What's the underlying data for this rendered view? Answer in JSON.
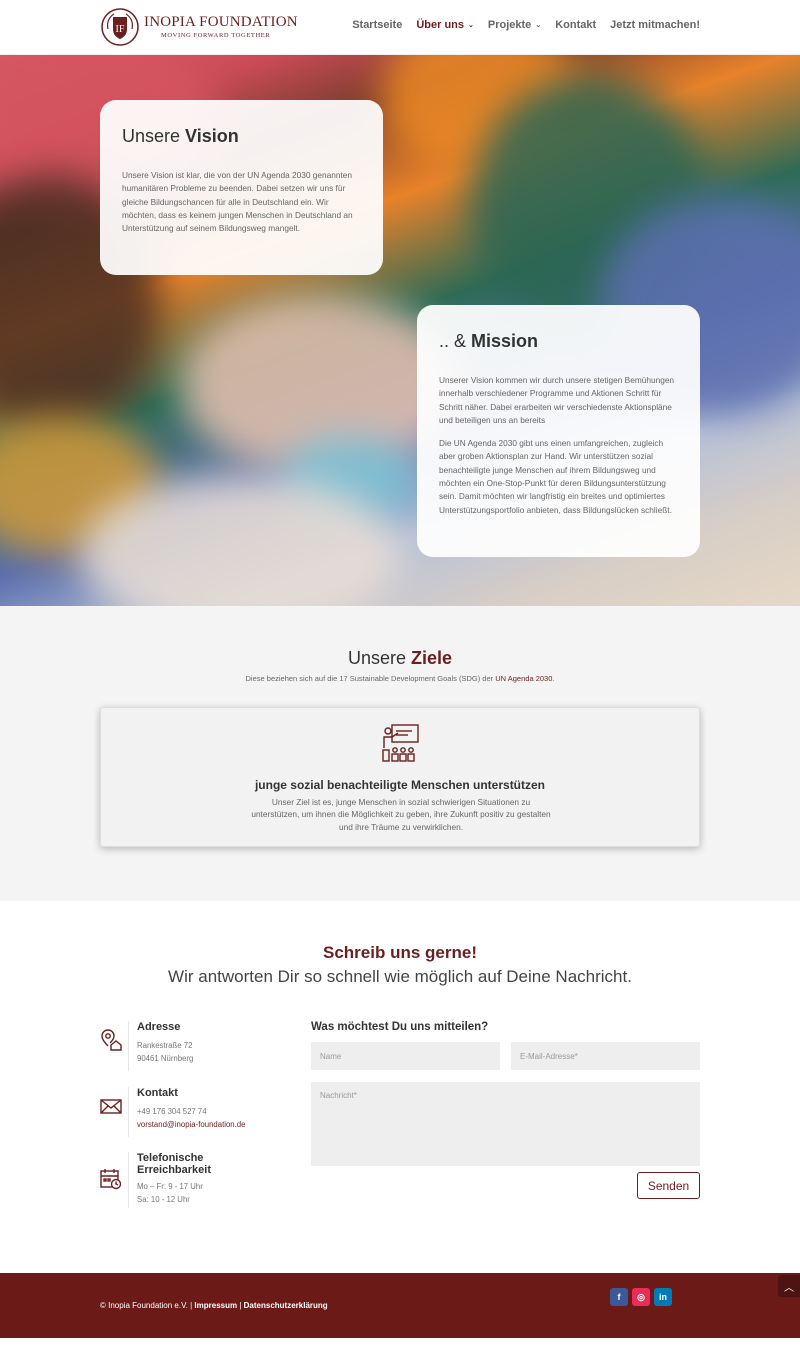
{
  "brand": {
    "name": "INOPIA FOUNDATION",
    "tagline": "MOVING FORWARD TOGETHER",
    "color": "#6b1f1f"
  },
  "nav": {
    "items": [
      {
        "label": "Startseite"
      },
      {
        "label": "Über uns"
      },
      {
        "label": "Projekte"
      },
      {
        "label": "Kontakt"
      },
      {
        "label": "Jetzt mitmachen!"
      }
    ]
  },
  "vision": {
    "title_prefix": "Unsere ",
    "title_bold": "Vision",
    "text": "Unsere Vision ist klar, die von der UN Agenda 2030 genannten humanitären Probleme zu beenden. Dabei setzen wir uns für gleiche Bildungschancen für alle in Deutschland ein. Wir möchten, dass es keinem jungen Menschen in Deutschland an Unterstützung auf seinem Bildungsweg mangelt."
  },
  "mission": {
    "title_prefix": ".. & ",
    "title_bold": "Mission",
    "text1": "Unserer Vision kommen wir durch unsere stetigen Bemühungen innerhalb verschiedener Programme und Aktionen Schritt für Schritt näher. Dabei erarbeiten wir verschiedenste Aktionspläne und beteiligen uns an bereits",
    "text2": "Die UN Agenda 2030 gibt uns einen umfangreichen, zugleich aber groben Aktionsplan zur Hand. Wir unterstützen sozial benachteiligte junge Menschen auf ihrem Bildungsweg und möchten ein One-Stop-Punkt für deren Bildungsunterstützung sein. Damit möchten wir langfristig ein breites und optimiertes Unterstützungsportfolio anbieten, dass Bildungslücken schließt."
  },
  "ziele": {
    "title_prefix": "Unsere ",
    "title_bold": "Ziele",
    "sub_text": "Diese beziehen sich auf die 17 Sustainable Development Goals (SDG) der ",
    "sub_link": "UN Agenda 2030",
    "sub_end": ".",
    "goal": {
      "icon": "teacher-classroom-icon",
      "title": "junge sozial benachteiligte Menschen unterstützen",
      "text": "Unser Ziel ist es, junge Menschen in sozial schwierigen Situationen zu unterstützen, um ihnen die Möglichkeit zu geben, ihre Zukunft positiv zu gestalten und ihre Träume zu verwirklichen."
    }
  },
  "contact": {
    "title": "Schreib uns gerne!",
    "tagline": "Wir antworten Dir so schnell wie möglich auf Deine Nachricht.",
    "address": {
      "title": "Adresse",
      "line1": "Rankestraße 72",
      "line2": "90461 Nürnberg"
    },
    "kontakt": {
      "title": "Kontakt",
      "phone": "+49 176 304 527 74",
      "email": "vorstand@inopia-foundation.de"
    },
    "hours": {
      "title_1": "Telefonische",
      "title_2": "Erreichbarkeit",
      "line1": "Mo – Fr: 9 - 17 Uhr",
      "line2": "Sa: 10 - 12 Uhr"
    },
    "form": {
      "title": "Was möchtest Du uns mitteilen?",
      "name_placeholder": "Name",
      "email_placeholder": "E-Mail-Adresse*",
      "message_placeholder": "Nachricht*",
      "send_label": "Senden"
    }
  },
  "footer": {
    "copyright": "© Inopia Foundation e.V. | ",
    "impressum": "Impressum",
    "separator": " | ",
    "datenschutz": "Datenschutzerklärung",
    "socials": [
      {
        "icon": "facebook-icon",
        "glyph": "f"
      },
      {
        "icon": "instagram-icon",
        "glyph": "◎"
      },
      {
        "icon": "linkedin-icon",
        "glyph": "in"
      }
    ],
    "to_top": "︿"
  }
}
